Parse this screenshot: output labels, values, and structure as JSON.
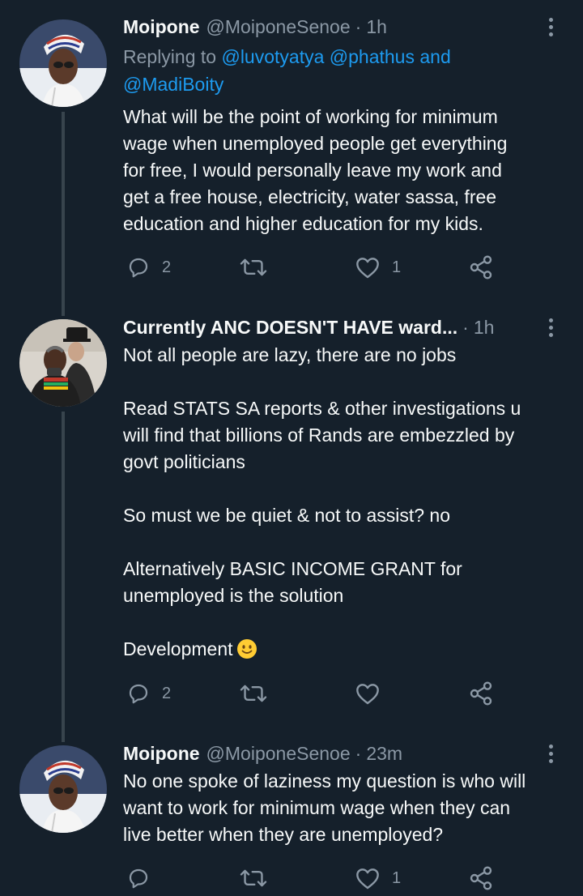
{
  "tweets": [
    {
      "name": "Moipone",
      "handle": "@MoiponeSenoe",
      "time": "1h",
      "replying_prefix": "Replying to ",
      "mentions": [
        "@luvotyatya",
        "@phathus",
        "@MadiBoity"
      ],
      "mention_joiner": " and ",
      "lines": [
        "What will be the point of working for minimum",
        "wage when unemployed people get everything",
        "for free, I would personally leave my work and",
        "get a free house, electricity, water sassa, free",
        "education and higher education for my kids."
      ],
      "reply_count": "2",
      "retweet_count": "",
      "like_count": "1"
    },
    {
      "name": "Currently ANC DOESN'T HAVE ward...",
      "time": "1h",
      "paragraphs": [
        [
          "Not all people are lazy, there are no jobs"
        ],
        [
          "Read STATS SA reports & other investigations u",
          "will find that billions of Rands are embezzled by",
          "govt politicians"
        ],
        [
          "So must we be quiet & not to assist? no"
        ],
        [
          "Alternatively BASIC INCOME GRANT for",
          "unemployed is the solution"
        ],
        [
          "Development"
        ]
      ],
      "emoji": "slightly-smiling-face",
      "reply_count": "2",
      "retweet_count": "",
      "like_count": ""
    },
    {
      "name": "Moipone",
      "handle": "@MoiponeSenoe",
      "time": "23m",
      "lines": [
        "No one spoke of laziness my question is who will",
        "want to work for minimum wage when they can",
        "live  better when they are unemployed?"
      ],
      "reply_count": "",
      "retweet_count": "",
      "like_count": "1"
    }
  ],
  "icons": {
    "reply": "reply-icon",
    "retweet": "retweet-icon",
    "like": "heart-icon",
    "share": "share-icon",
    "more": "more-options-icon"
  },
  "colors": {
    "background": "#15202b",
    "text": "#f7f9f9",
    "secondary": "#8b98a5",
    "link": "#1d9bf0",
    "thread_line": "#38444d"
  }
}
